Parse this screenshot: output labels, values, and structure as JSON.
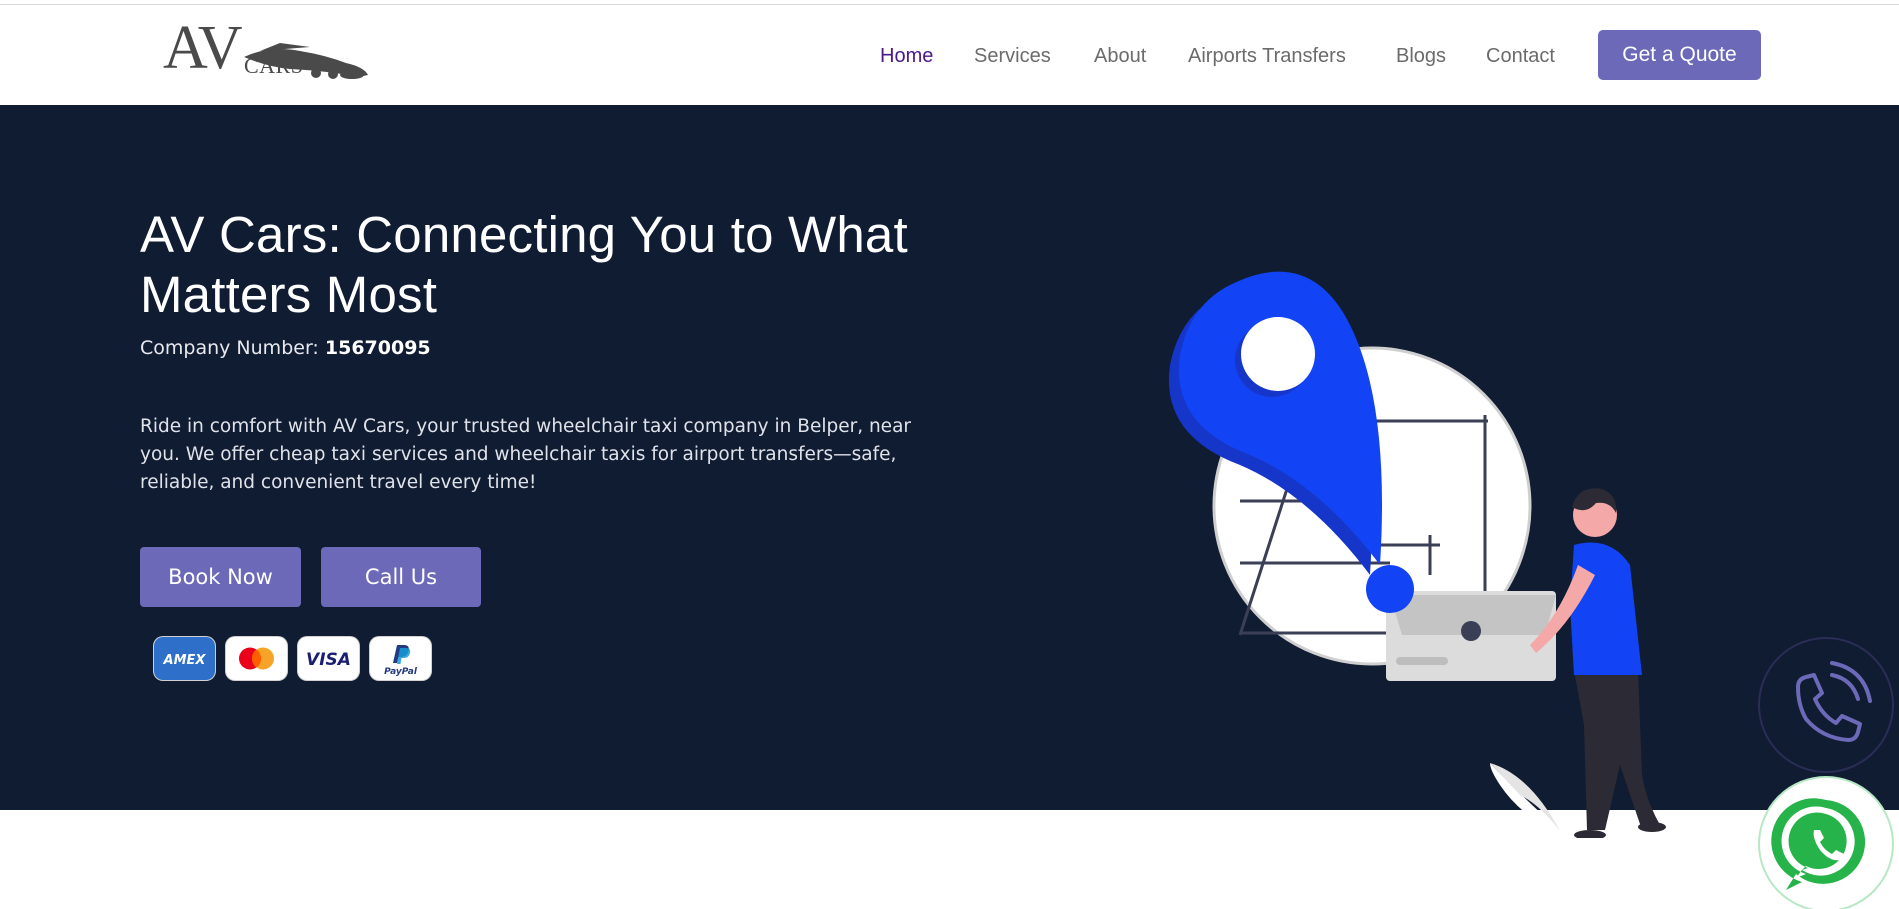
{
  "brand": {
    "logo_main": "AV",
    "logo_sub": "CARS"
  },
  "nav": {
    "items": [
      {
        "label": "Home",
        "active": true
      },
      {
        "label": "Services",
        "active": false
      },
      {
        "label": "About",
        "active": false
      },
      {
        "label": "Airports Transfers",
        "active": false
      },
      {
        "label": "Blogs",
        "active": false
      },
      {
        "label": "Contact",
        "active": false
      }
    ],
    "cta_label": "Get a Quote"
  },
  "hero": {
    "title": "AV Cars: Connecting You to What Matters Most",
    "company_label": "Company Number:",
    "company_number": "15670095",
    "description": "Ride in comfort with AV Cars, your trusted wheelchair taxi company in Belper, near you. We offer cheap taxi services and wheelchair taxis for airport transfers—safe, reliable, and convenient travel every time!",
    "book_label": "Book Now",
    "call_label": "Call Us"
  },
  "payments": [
    {
      "name": "AMEX",
      "icon": "amex-icon"
    },
    {
      "name": "Mastercard",
      "icon": "mastercard-icon"
    },
    {
      "name": "VISA",
      "icon": "visa-icon"
    },
    {
      "name": "PayPal",
      "icon": "paypal-icon"
    }
  ],
  "floating": {
    "phone_icon": "phone-icon",
    "whatsapp_icon": "whatsapp-icon"
  },
  "colors": {
    "hero_bg": "#101c32",
    "accent": "#6c69b8",
    "nav_active": "#4b1a8a",
    "pin_blue": "#1244f5"
  }
}
